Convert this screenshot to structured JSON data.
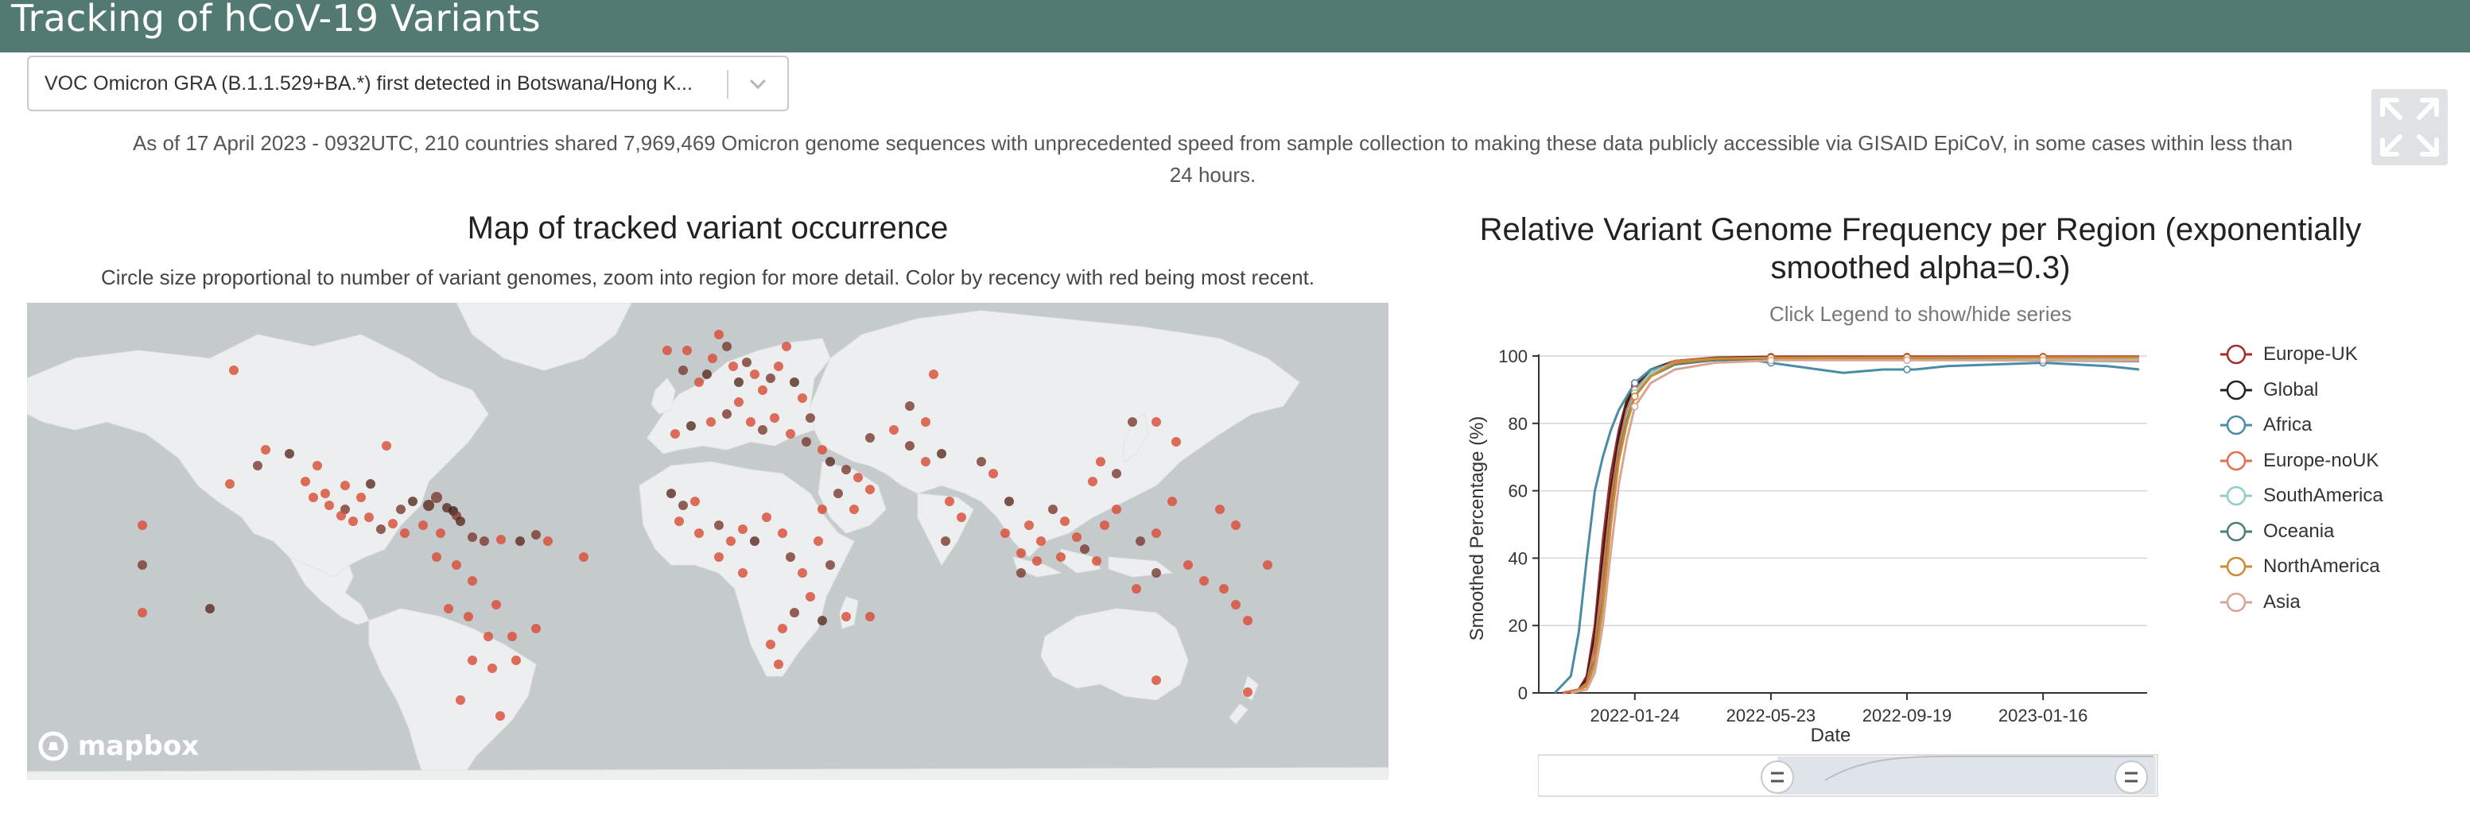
{
  "header": {
    "title": "Tracking of hCoV-19 Variants"
  },
  "variant_select": {
    "value": "VOC Omicron GRA (B.1.1.529+BA.*) first detected in Botswana/Hong K..."
  },
  "summary": "As of 17 April 2023 - 0932UTC, 210 countries shared 7,969,469 Omicron genome sequences with unprecedented speed from sample collection to making these data publicly accessible via GISAID EpiCoV, in some cases within less than 24 hours.",
  "map": {
    "title": "Map of tracked variant occurrence",
    "subtitle": "Circle size proportional to number of variant genomes, zoom into region for more detail. Color by recency with red being most recent.",
    "attribution": "mapbox"
  },
  "chart": {
    "title": "Relative Variant Genome Frequency per Region (exponentially smoothed alpha=0.3)",
    "hint": "Click Legend to show/hide series"
  },
  "chart_data": {
    "type": "line",
    "ylabel": "Smoothed Percentage (%)",
    "xlabel": "Date",
    "ylim": [
      0,
      100
    ],
    "yticks": [
      "0",
      "20",
      "40",
      "60",
      "80",
      "100"
    ],
    "xticks": [
      "2022-01-24",
      "2022-05-23",
      "2022-09-19",
      "2023-01-16"
    ],
    "grid": "horizontal",
    "legend_position": "right",
    "series": [
      {
        "name": "Europe-UK",
        "color": "#a52a2a",
        "points": [
          [
            "2021-11-22",
            0
          ],
          [
            "2021-12-06",
            1
          ],
          [
            "2021-12-13",
            5
          ],
          [
            "2021-12-20",
            20
          ],
          [
            "2021-12-27",
            45
          ],
          [
            "2022-01-03",
            65
          ],
          [
            "2022-01-10",
            78
          ],
          [
            "2022-01-17",
            87
          ],
          [
            "2022-01-24",
            92
          ],
          [
            "2022-02-07",
            96
          ],
          [
            "2022-02-28",
            98.5
          ],
          [
            "2022-04-04",
            99.5
          ],
          [
            "2022-06-01",
            99.8
          ],
          [
            "2023-04-10",
            99.8
          ]
        ]
      },
      {
        "name": "Global",
        "color": "#222222",
        "points": [
          [
            "2021-11-22",
            0
          ],
          [
            "2021-12-06",
            1
          ],
          [
            "2021-12-13",
            4
          ],
          [
            "2021-12-20",
            17
          ],
          [
            "2021-12-27",
            40
          ],
          [
            "2022-01-03",
            60
          ],
          [
            "2022-01-10",
            76
          ],
          [
            "2022-01-17",
            86
          ],
          [
            "2022-01-24",
            91
          ],
          [
            "2022-02-07",
            96
          ],
          [
            "2022-02-28",
            98.5
          ],
          [
            "2022-04-04",
            99.4
          ],
          [
            "2022-06-01",
            99.6
          ],
          [
            "2023-04-10",
            99.5
          ]
        ]
      },
      {
        "name": "Africa",
        "color": "#4a8ca8",
        "points": [
          [
            "2021-11-15",
            0
          ],
          [
            "2021-11-29",
            5
          ],
          [
            "2021-12-06",
            18
          ],
          [
            "2021-12-13",
            40
          ],
          [
            "2021-12-20",
            60
          ],
          [
            "2021-12-27",
            70
          ],
          [
            "2022-01-03",
            78
          ],
          [
            "2022-01-10",
            84
          ],
          [
            "2022-01-17",
            88
          ],
          [
            "2022-01-24",
            92
          ],
          [
            "2022-02-07",
            96
          ],
          [
            "2022-03-07",
            98.5
          ],
          [
            "2022-05-01",
            99
          ],
          [
            "2022-07-25",
            95
          ],
          [
            "2022-08-29",
            96
          ],
          [
            "2022-09-26",
            96
          ],
          [
            "2022-10-24",
            97
          ],
          [
            "2023-01-16",
            98
          ],
          [
            "2023-03-13",
            97
          ],
          [
            "2023-04-10",
            96
          ]
        ]
      },
      {
        "name": "Europe-noUK",
        "color": "#e06e4a",
        "points": [
          [
            "2021-11-22",
            0
          ],
          [
            "2021-12-06",
            1
          ],
          [
            "2021-12-13",
            3
          ],
          [
            "2021-12-20",
            14
          ],
          [
            "2021-12-27",
            35
          ],
          [
            "2022-01-03",
            57
          ],
          [
            "2022-01-10",
            73
          ],
          [
            "2022-01-17",
            84
          ],
          [
            "2022-01-24",
            90
          ],
          [
            "2022-02-07",
            95
          ],
          [
            "2022-02-28",
            98.5
          ],
          [
            "2022-04-04",
            99.3
          ],
          [
            "2022-06-01",
            99.5
          ],
          [
            "2023-04-10",
            99.3
          ]
        ]
      },
      {
        "name": "SouthAmerica",
        "color": "#8ccfc7",
        "points": [
          [
            "2021-11-29",
            0
          ],
          [
            "2021-12-13",
            2
          ],
          [
            "2021-12-20",
            8
          ],
          [
            "2021-12-27",
            25
          ],
          [
            "2022-01-03",
            50
          ],
          [
            "2022-01-10",
            70
          ],
          [
            "2022-01-17",
            82
          ],
          [
            "2022-01-24",
            89
          ],
          [
            "2022-02-07",
            95
          ],
          [
            "2022-02-28",
            98
          ],
          [
            "2022-04-04",
            99
          ],
          [
            "2022-06-01",
            99.3
          ],
          [
            "2023-04-10",
            99.2
          ]
        ]
      },
      {
        "name": "Oceania",
        "color": "#4d7d77",
        "points": [
          [
            "2021-11-29",
            0
          ],
          [
            "2021-12-13",
            2
          ],
          [
            "2021-12-20",
            10
          ],
          [
            "2021-12-27",
            28
          ],
          [
            "2022-01-03",
            52
          ],
          [
            "2022-01-10",
            70
          ],
          [
            "2022-01-17",
            81
          ],
          [
            "2022-01-24",
            88
          ],
          [
            "2022-02-07",
            94
          ],
          [
            "2022-02-28",
            97.5
          ],
          [
            "2022-04-04",
            98.8
          ],
          [
            "2022-06-01",
            99.2
          ],
          [
            "2023-04-10",
            98.5
          ]
        ]
      },
      {
        "name": "NorthAmerica",
        "color": "#cf8a2e",
        "points": [
          [
            "2021-11-29",
            0
          ],
          [
            "2021-12-13",
            2
          ],
          [
            "2021-12-20",
            9
          ],
          [
            "2021-12-27",
            26
          ],
          [
            "2022-01-03",
            50
          ],
          [
            "2022-01-10",
            69
          ],
          [
            "2022-01-17",
            80
          ],
          [
            "2022-01-24",
            88
          ],
          [
            "2022-02-07",
            94
          ],
          [
            "2022-02-28",
            98
          ],
          [
            "2022-04-04",
            99.2
          ],
          [
            "2022-06-01",
            99.5
          ],
          [
            "2023-04-10",
            99.6
          ]
        ]
      },
      {
        "name": "Asia",
        "color": "#d8a595",
        "points": [
          [
            "2021-11-29",
            0
          ],
          [
            "2021-12-13",
            1
          ],
          [
            "2021-12-20",
            6
          ],
          [
            "2021-12-27",
            20
          ],
          [
            "2022-01-03",
            42
          ],
          [
            "2022-01-10",
            62
          ],
          [
            "2022-01-17",
            75
          ],
          [
            "2022-01-24",
            85
          ],
          [
            "2022-02-07",
            92
          ],
          [
            "2022-02-28",
            96
          ],
          [
            "2022-04-04",
            98
          ],
          [
            "2022-06-01",
            98.8
          ],
          [
            "2023-04-10",
            98.7
          ]
        ]
      }
    ]
  }
}
